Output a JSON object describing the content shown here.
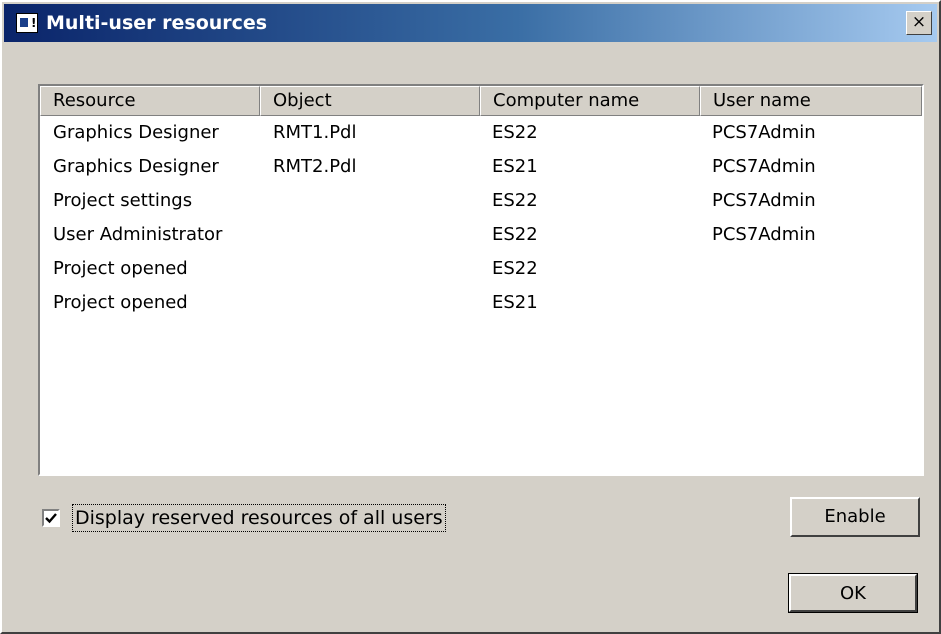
{
  "window": {
    "title": "Multi-user resources",
    "close_glyph": "×"
  },
  "table": {
    "columns": [
      "Resource",
      "Object",
      "Computer name",
      "User name"
    ],
    "rows": [
      [
        "Graphics Designer",
        "RMT1.Pdl",
        "ES22",
        "PCS7Admin"
      ],
      [
        "Graphics Designer",
        "RMT2.Pdl",
        "ES21",
        "PCS7Admin"
      ],
      [
        "Project settings",
        "",
        "ES22",
        "PCS7Admin"
      ],
      [
        "User Administrator",
        "",
        "ES22",
        "PCS7Admin"
      ],
      [
        "Project opened",
        "",
        "ES22",
        ""
      ],
      [
        "Project opened",
        "",
        "ES21",
        ""
      ]
    ]
  },
  "options": {
    "display_all_label": "Display reserved resources of all users",
    "display_all_checked": true
  },
  "buttons": {
    "enable": "Enable",
    "ok": "OK"
  },
  "icons": {
    "window_icon": "app-window-icon",
    "checkmark": "checkmark-icon"
  }
}
